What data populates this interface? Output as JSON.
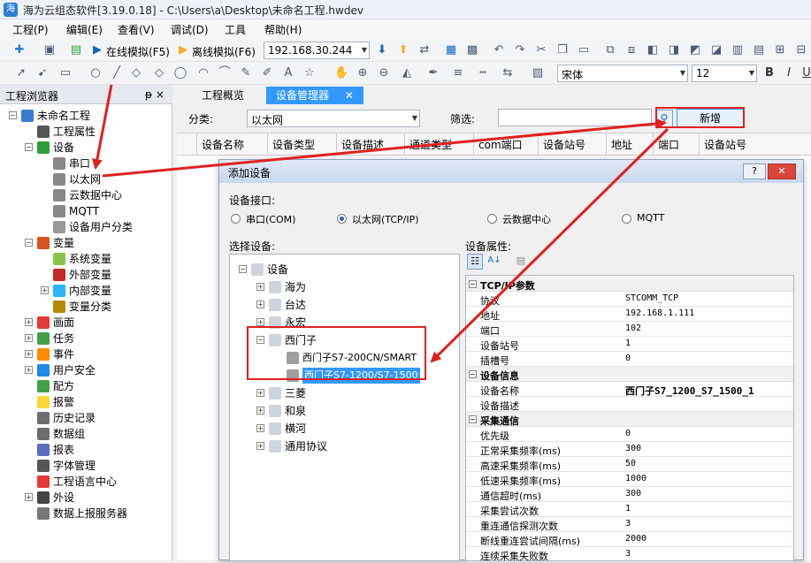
{
  "window": {
    "title": "海为云组态软件[3.19.0.18] - C:\\Users\\a\\Desktop\\未命名工程.hwdev"
  },
  "menu": [
    "工程(P)",
    "编辑(E)",
    "查看(V)",
    "调试(D)",
    "工具",
    "帮助(H)"
  ],
  "toolbar": {
    "online_sim": "在线模拟(F5)",
    "offline_sim": "离线模拟(F6)",
    "ip": "192.168.30.244",
    "font": "宋体",
    "font_size": "12"
  },
  "left_panel": {
    "title": "工程浏览器",
    "pin": "ᵽ ×",
    "tree": [
      {
        "label": "未命名工程",
        "level": 0,
        "exp": "-",
        "color": "#3a7bd5"
      },
      {
        "label": "工程属性",
        "level": 1,
        "exp": "",
        "color": "#555555"
      },
      {
        "label": "设备",
        "level": 1,
        "exp": "-",
        "color": "#2e9e3a"
      },
      {
        "label": "串口",
        "level": 2,
        "exp": "",
        "color": "#888888"
      },
      {
        "label": "以太网",
        "level": 2,
        "exp": "",
        "color": "#888888"
      },
      {
        "label": "云数据中心",
        "level": 2,
        "exp": "",
        "color": "#888888"
      },
      {
        "label": "MQTT",
        "level": 2,
        "exp": "",
        "color": "#888888"
      },
      {
        "label": "设备用户分类",
        "level": 2,
        "exp": "",
        "color": "#999999"
      },
      {
        "label": "变量",
        "level": 1,
        "exp": "-",
        "color": "#d9531e"
      },
      {
        "label": "系统变量",
        "level": 2,
        "exp": "",
        "color": "#8bc34a"
      },
      {
        "label": "外部变量",
        "level": 2,
        "exp": "",
        "color": "#c62828"
      },
      {
        "label": "内部变量",
        "level": 2,
        "exp": "+",
        "color": "#29b6f6"
      },
      {
        "label": "变量分类",
        "level": 2,
        "exp": "",
        "color": "#b58900"
      },
      {
        "label": "画面",
        "level": 1,
        "exp": "+",
        "color": "#e53935"
      },
      {
        "label": "任务",
        "level": 1,
        "exp": "+",
        "color": "#43a047"
      },
      {
        "label": "事件",
        "level": 1,
        "exp": "+",
        "color": "#fb8c00"
      },
      {
        "label": "用户安全",
        "level": 1,
        "exp": "+",
        "color": "#1e88e5"
      },
      {
        "label": "配方",
        "level": 1,
        "exp": "",
        "color": "#43a047"
      },
      {
        "label": "报警",
        "level": 1,
        "exp": "",
        "color": "#fdd835"
      },
      {
        "label": "历史记录",
        "level": 1,
        "exp": "",
        "color": "#6d6d6d"
      },
      {
        "label": "数据组",
        "level": 1,
        "exp": "",
        "color": "#6d6d6d"
      },
      {
        "label": "报表",
        "level": 1,
        "exp": "",
        "color": "#5c6bc0"
      },
      {
        "label": "字体管理",
        "level": 1,
        "exp": "",
        "color": "#555555"
      },
      {
        "label": "工程语言中心",
        "level": 1,
        "exp": "",
        "color": "#e53935"
      },
      {
        "label": "外设",
        "level": 1,
        "exp": "+",
        "color": "#444444"
      },
      {
        "label": "数据上报服务器",
        "level": 1,
        "exp": "",
        "color": "#777777"
      }
    ]
  },
  "tabs": [
    {
      "label": "工程概览",
      "active": false
    },
    {
      "label": "设备管理器",
      "active": true,
      "close": "✕"
    }
  ],
  "device_manager": {
    "category_label": "分类:",
    "category_value": "以太网",
    "filter_label": "筛选:",
    "filter_value": "",
    "add_button": "新增",
    "columns": [
      "设备名称",
      "设备类型",
      "设备描述",
      "通道类型",
      "com端口",
      "设备站号",
      "地址",
      "端口",
      "设备站号"
    ]
  },
  "dialog": {
    "title": "添加设备",
    "help": "?",
    "close": "✕",
    "interface_label": "设备接口:",
    "interfaces": [
      {
        "label": "串口(COM)",
        "selected": false
      },
      {
        "label": "以太网(TCP/IP)",
        "selected": true
      },
      {
        "label": "云数据中心",
        "selected": false
      },
      {
        "label": "MQTT",
        "selected": false
      }
    ],
    "select_label": "选择设备:",
    "device_tree": [
      {
        "label": "设备",
        "level": 0,
        "exp": "-"
      },
      {
        "label": "海为",
        "level": 1,
        "exp": "+"
      },
      {
        "label": "台达",
        "level": 1,
        "exp": "+"
      },
      {
        "label": "永宏",
        "level": 1,
        "exp": "+"
      },
      {
        "label": "西门子",
        "level": 1,
        "exp": "-"
      },
      {
        "label": "西门子S7-200CN/SMART",
        "level": 2,
        "exp": ""
      },
      {
        "label": "西门子S7-1200/S7-1500",
        "level": 2,
        "exp": "",
        "selected": true
      },
      {
        "label": "三菱",
        "level": 1,
        "exp": "+"
      },
      {
        "label": "和泉",
        "level": 1,
        "exp": "+"
      },
      {
        "label": "横河",
        "level": 1,
        "exp": "+"
      },
      {
        "label": "通用协议",
        "level": 1,
        "exp": "+"
      }
    ],
    "props_label": "设备属性:",
    "properties": [
      {
        "cat": "TCP/IP参数"
      },
      {
        "name": "协议",
        "value": "STCOMM_TCP"
      },
      {
        "name": "地址",
        "value": "192.168.1.111"
      },
      {
        "name": "端口",
        "value": "102"
      },
      {
        "name": "设备站号",
        "value": "1"
      },
      {
        "name": "插槽号",
        "value": "0"
      },
      {
        "cat": "设备信息"
      },
      {
        "name": "设备名称",
        "value": "西门子S7_1200_S7_1500_1",
        "bold": true
      },
      {
        "name": "设备描述",
        "value": ""
      },
      {
        "cat": "采集通信"
      },
      {
        "name": "优先级",
        "value": "0"
      },
      {
        "name": "正常采集频率(ms)",
        "value": "300"
      },
      {
        "name": "高速采集频率(ms)",
        "value": "50"
      },
      {
        "name": "低速采集频率(ms)",
        "value": "1000"
      },
      {
        "name": "通信超时(ms)",
        "value": "300"
      },
      {
        "name": "采集尝试次数",
        "value": "1"
      },
      {
        "name": "重连通信探测次数",
        "value": "3"
      },
      {
        "name": "断线重连尝试间隔(ms)",
        "value": "2000"
      },
      {
        "name": "连续采集失败数",
        "value": "3"
      }
    ]
  },
  "colors": {
    "accent": "#3399ff",
    "annotation": "#e02020",
    "selection": "#3399ff"
  }
}
